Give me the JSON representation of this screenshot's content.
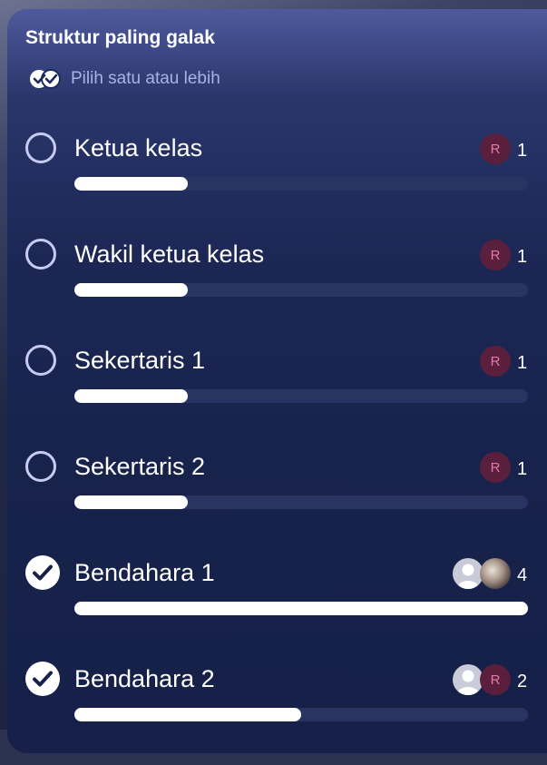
{
  "poll": {
    "title": "Struktur paling galak",
    "hint": "Pilih satu atau lebih",
    "options": [
      {
        "label": "Ketua kelas",
        "voters": [
          "R"
        ],
        "count": "1",
        "selected": false,
        "share": 0.25
      },
      {
        "label": "Wakil ketua kelas",
        "voters": [
          "R"
        ],
        "count": "1",
        "selected": false,
        "share": 0.25
      },
      {
        "label": "Sekertaris 1",
        "voters": [
          "R"
        ],
        "count": "1",
        "selected": false,
        "share": 0.25
      },
      {
        "label": "Sekertaris 2",
        "voters": [
          "R"
        ],
        "count": "1",
        "selected": false,
        "share": 0.25
      },
      {
        "label": "Bendahara 1",
        "voters": [
          "default-avatar",
          "photo-avatar"
        ],
        "count": "4",
        "selected": true,
        "share": 1.0
      },
      {
        "label": "Bendahara 2",
        "voters": [
          "default-avatar",
          "R"
        ],
        "count": "2",
        "selected": true,
        "share": 0.5
      }
    ]
  },
  "icons": {
    "hint": "double-check-icon",
    "unselected": "radio-circle-icon",
    "selected": "check-circle-icon"
  },
  "colors": {
    "accent_light": "#c7cbf2",
    "bar_fill": "#ffffff",
    "bar_track": "#2a3463",
    "avatar_r_bg": "#5a1f3c",
    "avatar_r_text": "#e37aa3"
  }
}
